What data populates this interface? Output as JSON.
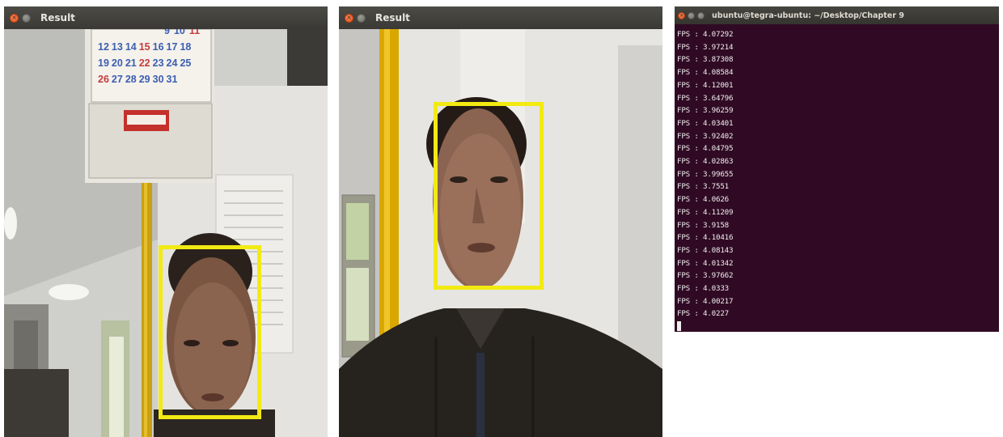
{
  "windows": {
    "left": {
      "title": "Result"
    },
    "middle": {
      "title": "Result"
    },
    "terminal": {
      "title": "ubuntu@tegra-ubuntu: ~/Desktop/Chapter 9",
      "lines": [
        "FPS : 4.07292",
        "FPS : 3.97214",
        "FPS : 3.87308",
        "FPS : 4.08584",
        "FPS : 4.12001",
        "FPS : 3.64796",
        "FPS : 3.96259",
        "FPS : 4.03401",
        "FPS : 3.92402",
        "FPS : 4.04795",
        "FPS : 4.02863",
        "FPS : 3.99655",
        "FPS : 3.7551",
        "FPS : 4.0626",
        "FPS : 4.11209",
        "FPS : 3.9158",
        "FPS : 4.10416",
        "FPS : 4.08143",
        "FPS : 4.01342",
        "FPS : 3.97662",
        "FPS : 4.0333",
        "FPS : 4.00217",
        "FPS : 4.0227"
      ]
    }
  },
  "calendar": {
    "rows": [
      [
        "12",
        "13",
        "14",
        "15",
        "16",
        "17",
        "18"
      ],
      [
        "19",
        "20",
        "21",
        "22",
        "23",
        "24",
        "25"
      ],
      [
        "26",
        "27",
        "28",
        "29",
        "30",
        "31",
        ""
      ]
    ],
    "partial_top": [
      "9",
      "10",
      "11"
    ]
  },
  "colors": {
    "face_box": "#f2ea12",
    "terminal_bg": "#300a24",
    "close_button": "#e2501c"
  }
}
